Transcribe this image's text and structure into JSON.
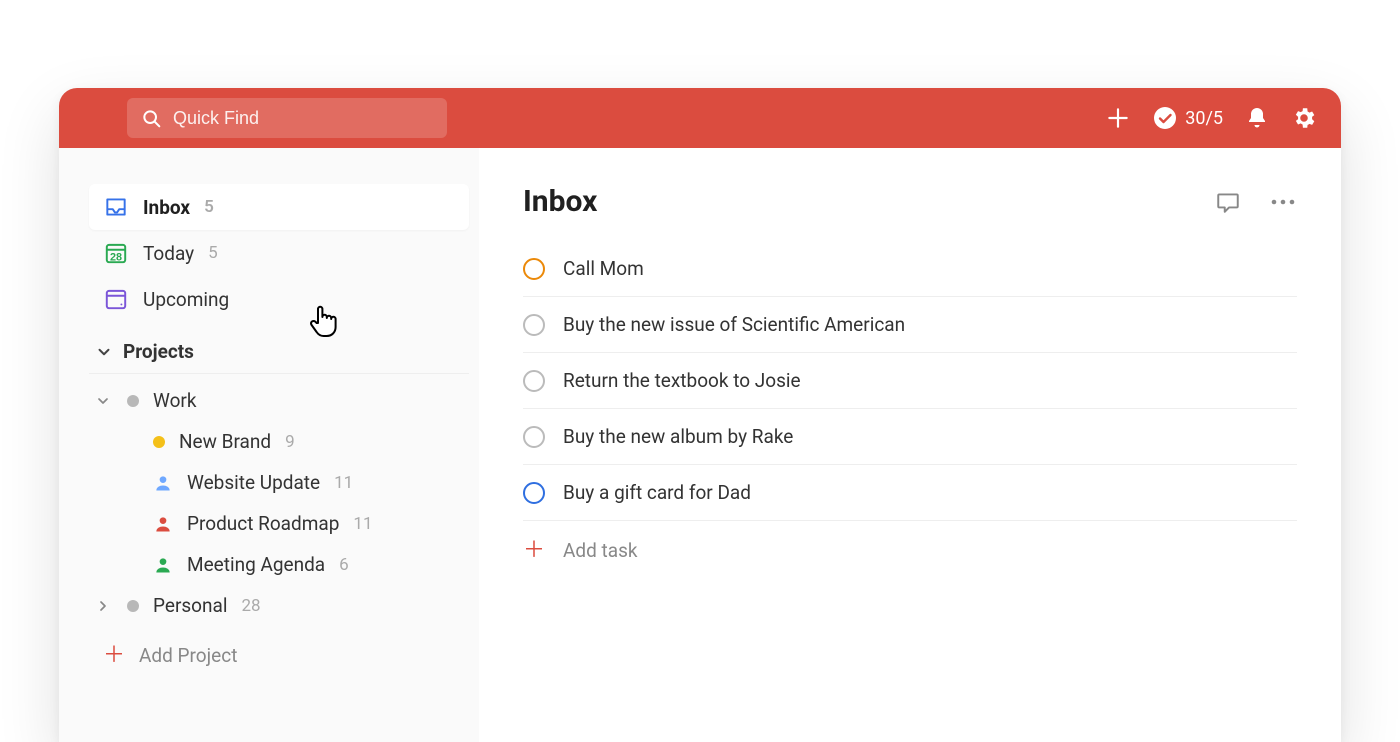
{
  "topbar": {
    "search_placeholder": "Quick Find",
    "karma_count": "30/5"
  },
  "sidebar": {
    "items": [
      {
        "key": "inbox",
        "label": "Inbox",
        "count": "5",
        "active": true
      },
      {
        "key": "today",
        "label": "Today",
        "count": "5",
        "active": false
      },
      {
        "key": "upcoming",
        "label": "Upcoming",
        "count": "",
        "active": false
      }
    ],
    "projects_header": "Projects",
    "projects": [
      {
        "key": "work",
        "label": "Work",
        "count": "",
        "color": "#b8b8b8",
        "expanded": true,
        "sub": [
          {
            "key": "new-brand",
            "label": "New Brand",
            "count": "9",
            "color": "#f4c019"
          },
          {
            "key": "website-update",
            "label": "Website Update",
            "count": "11",
            "color": "#6fa8ff"
          },
          {
            "key": "product-roadmap",
            "label": "Product Roadmap",
            "count": "11",
            "color": "#db4c3f"
          },
          {
            "key": "meeting-agenda",
            "label": "Meeting Agenda",
            "count": "6",
            "color": "#2aa952"
          }
        ]
      },
      {
        "key": "personal",
        "label": "Personal",
        "count": "28",
        "color": "#b8b8b8",
        "expanded": false,
        "sub": []
      }
    ],
    "add_project_label": "Add Project"
  },
  "content": {
    "title": "Inbox",
    "tasks": [
      {
        "text": "Call Mom",
        "priority": "orange"
      },
      {
        "text": "Buy the new issue of Scientific American",
        "priority": ""
      },
      {
        "text": "Return the textbook to Josie",
        "priority": ""
      },
      {
        "text": "Buy the new album by Rake",
        "priority": ""
      },
      {
        "text": "Buy a gift card for Dad",
        "priority": "blue"
      }
    ],
    "add_task_label": "Add task"
  }
}
